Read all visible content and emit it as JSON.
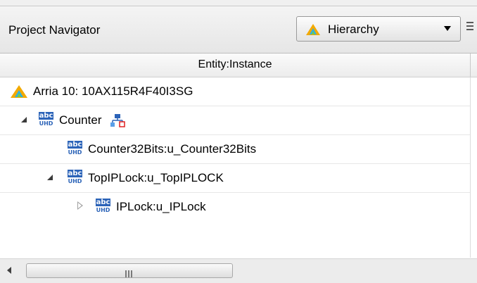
{
  "header": {
    "title": "Project Navigator",
    "view_dropdown": {
      "selected": "Hierarchy"
    }
  },
  "table": {
    "column_header": "Entity:Instance"
  },
  "tree": {
    "device": "Arria 10: 10AX115R4F40I3SG",
    "top": "Counter",
    "child1": "Counter32Bits:u_Counter32Bits",
    "child2": "TopIPLock:u_TopIPLOCK",
    "grandchild": "IPLock:u_IPLock"
  },
  "icons": {
    "device": "altera-device-icon",
    "entity": "abc-uhd-entity-icon",
    "top_level": "hierarchy-top-level-icon",
    "expand_open": "expanded-triangle-icon",
    "expand_closed": "collapsed-triangle-icon",
    "menu": "panel-menu-icon"
  },
  "scrollbar": {
    "thumb_grip": "III"
  },
  "colors": {
    "entity_icon": "#2b63b8",
    "device_icon": "#f2a900"
  }
}
